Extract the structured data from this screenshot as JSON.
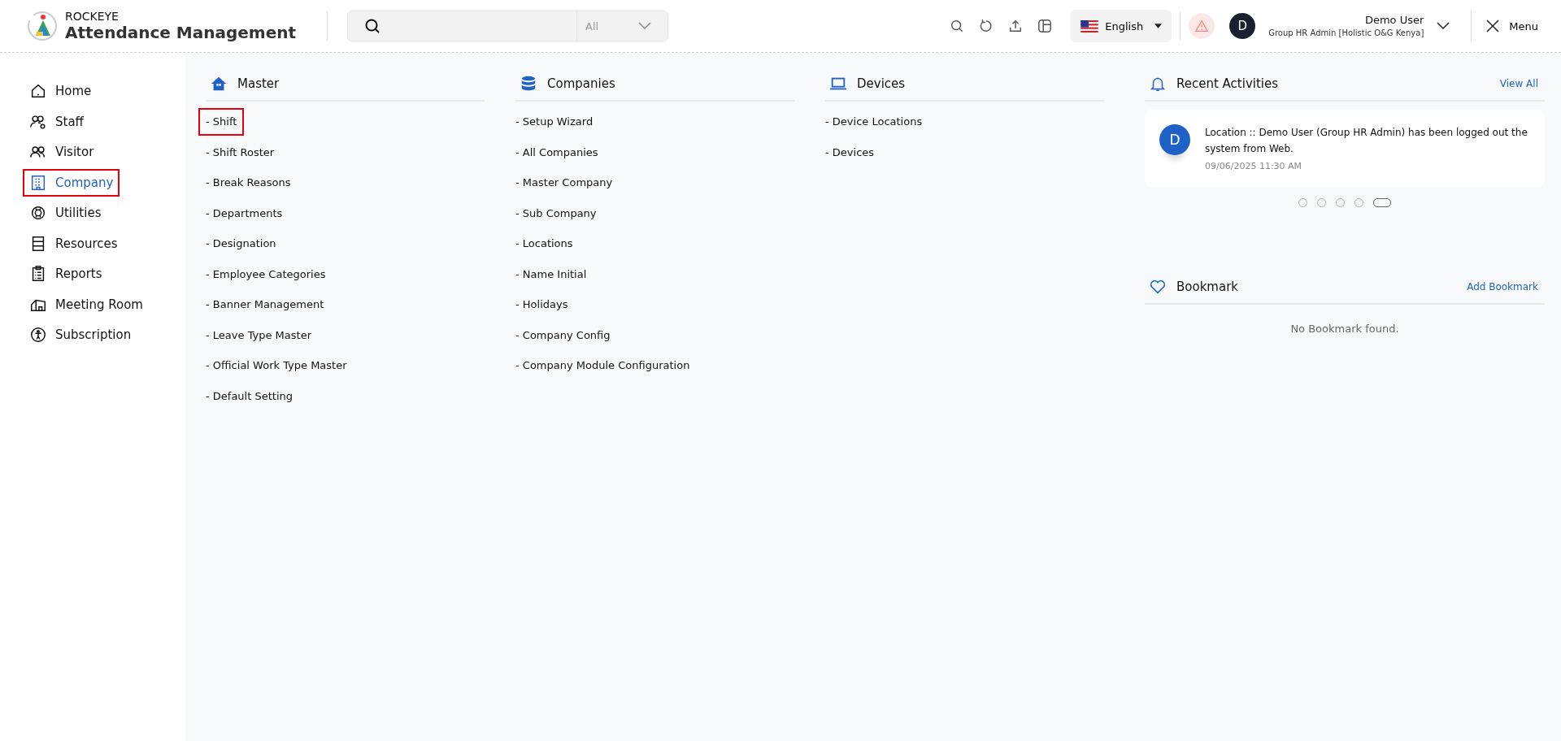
{
  "header": {
    "brand_top": "ROCKEYE",
    "brand_title": "Attendance Management",
    "search_scope": "All",
    "language": "English",
    "user_initial": "D",
    "user_name": "Demo User",
    "user_role": "Group HR Admin [Holistic O&G Kenya]",
    "menu_label": "Menu"
  },
  "sidebar": {
    "items": [
      {
        "label": "Home",
        "selected": false,
        "highlighted": false
      },
      {
        "label": "Staff",
        "selected": false,
        "highlighted": false
      },
      {
        "label": "Visitor",
        "selected": false,
        "highlighted": false
      },
      {
        "label": "Company",
        "selected": true,
        "highlighted": true
      },
      {
        "label": "Utilities",
        "selected": false,
        "highlighted": false
      },
      {
        "label": "Resources",
        "selected": false,
        "highlighted": false
      },
      {
        "label": "Reports",
        "selected": false,
        "highlighted": false
      },
      {
        "label": "Meeting Room",
        "selected": false,
        "highlighted": false
      },
      {
        "label": "Subscription",
        "selected": false,
        "highlighted": false
      }
    ]
  },
  "sections": [
    {
      "title": "Master",
      "links": [
        {
          "label": "- Shift",
          "highlighted": true
        },
        {
          "label": "- Shift Roster",
          "highlighted": false
        },
        {
          "label": "- Break Reasons",
          "highlighted": false
        },
        {
          "label": "- Departments",
          "highlighted": false
        },
        {
          "label": "- Designation",
          "highlighted": false
        },
        {
          "label": "- Employee Categories",
          "highlighted": false
        },
        {
          "label": "- Banner Management",
          "highlighted": false
        },
        {
          "label": "- Leave Type Master",
          "highlighted": false
        },
        {
          "label": "- Official Work Type Master",
          "highlighted": false
        },
        {
          "label": "- Default Setting",
          "highlighted": false
        }
      ]
    },
    {
      "title": "Companies",
      "links": [
        {
          "label": "- Setup Wizard",
          "highlighted": false
        },
        {
          "label": "- All Companies",
          "highlighted": false
        },
        {
          "label": "- Master Company",
          "highlighted": false
        },
        {
          "label": "- Sub Company",
          "highlighted": false
        },
        {
          "label": "- Locations",
          "highlighted": false
        },
        {
          "label": "- Name Initial",
          "highlighted": false
        },
        {
          "label": "- Holidays",
          "highlighted": false
        },
        {
          "label": "- Company Config",
          "highlighted": false
        },
        {
          "label": "- Company Module Configuration",
          "highlighted": false
        }
      ]
    },
    {
      "title": "Devices",
      "links": [
        {
          "label": "- Device Locations",
          "highlighted": false
        },
        {
          "label": "- Devices",
          "highlighted": false
        }
      ]
    }
  ],
  "recent_activities": {
    "title": "Recent Activities",
    "action": "View All",
    "activity": {
      "initial": "D",
      "text": "Location :: Demo User (Group HR Admin) has been logged out the system from Web.",
      "time": "09/06/2025 11:30 AM"
    },
    "pager": [
      {
        "selected": false
      },
      {
        "selected": false
      },
      {
        "selected": false
      },
      {
        "selected": false
      },
      {
        "selected": true
      }
    ]
  },
  "bookmark": {
    "title": "Bookmark",
    "action": "Add Bookmark",
    "empty": "No Bookmark found."
  }
}
